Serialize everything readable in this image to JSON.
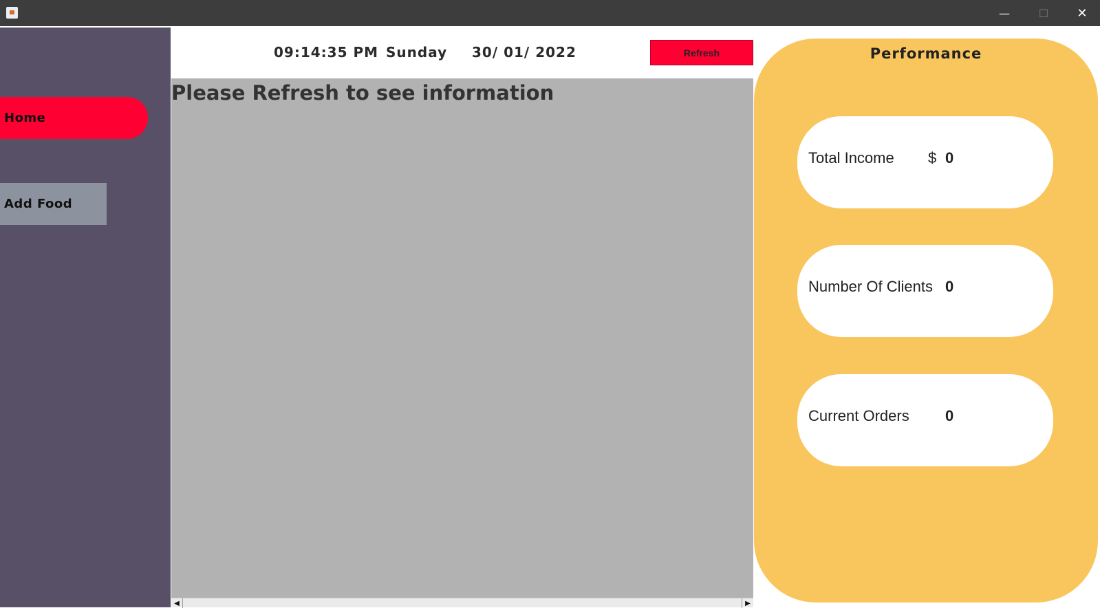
{
  "window": {
    "minimize_glyph": "—",
    "maximize_glyph": "☐",
    "close_glyph": "✕"
  },
  "sidebar": {
    "items": [
      {
        "label": "Home",
        "active": true,
        "color": "#ff0033"
      },
      {
        "label": "Add Food",
        "active": false,
        "color": "#8c939e"
      }
    ]
  },
  "header": {
    "time": "09:14:35 PM",
    "day": "Sunday",
    "date": "30/ 01/ 2022",
    "refresh_label": "Refresh"
  },
  "content": {
    "message": "Please Refresh to see information"
  },
  "performance": {
    "title": "Performance",
    "total_income": {
      "label": "Total Income",
      "currency": "$",
      "value": "0"
    },
    "clients": {
      "label": "Number Of Clients",
      "value": "0"
    },
    "orders": {
      "label": "Current Orders",
      "value": "0"
    }
  },
  "colors": {
    "sidebar_bg": "#575067",
    "accent_red": "#ff0033",
    "panel_yellow": "#f8c65d",
    "content_gray": "#b2b2b2"
  }
}
